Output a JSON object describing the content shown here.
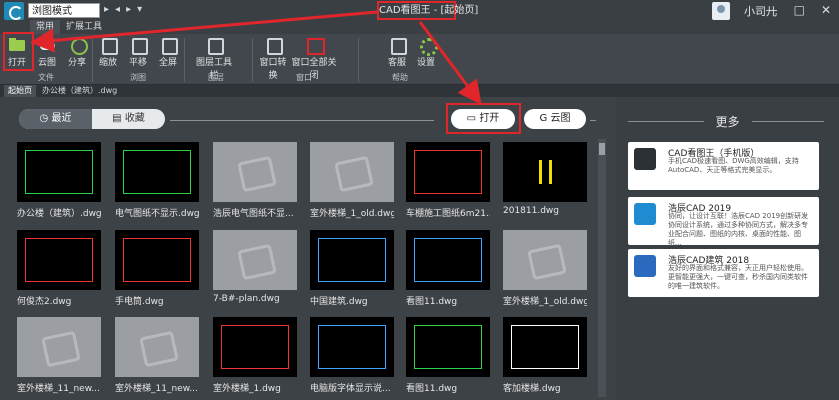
{
  "titlebar": {
    "mode": "浏图模式",
    "title": "CAD看图王 - [起始页]",
    "user_name": "小司儿",
    "btn_min": "—",
    "btn_max": "□",
    "btn_close": "✕"
  },
  "menu_tabs": [
    "常用",
    "扩展工具"
  ],
  "ribbon": {
    "buttons": [
      "打开",
      "云图",
      "分享",
      "缩放",
      "平移",
      "全屏",
      "图层工具栏",
      "窗口转换",
      "窗口全部关闭",
      "客服",
      "设置"
    ],
    "groups": [
      "文件",
      "浏图",
      "图层",
      "窗口",
      "帮助"
    ]
  },
  "doc_tabs": [
    "起始页",
    "办公楼（建筑）.dwg"
  ],
  "main": {
    "seg_recent": "最近",
    "seg_fav": "收藏",
    "open_btn": "打开",
    "cloud_btn": "云图"
  },
  "files": [
    {
      "name": "办公楼（建筑）.dwg"
    },
    {
      "name": "电气图纸不显示.dwg"
    },
    {
      "name": "浩辰电气图纸不显..."
    },
    {
      "name": "室外楼梯_1_old.dwg"
    },
    {
      "name": "车棚施工图纸6m21..."
    },
    {
      "name": "201811.dwg"
    },
    {
      "name": "何俊杰2.dwg"
    },
    {
      "name": "手电筒.dwg"
    },
    {
      "name": "7-B#-plan.dwg"
    },
    {
      "name": "中国建筑.dwg"
    },
    {
      "name": "看图11.dwg"
    },
    {
      "name": "室外楼梯_1_old.dwg"
    },
    {
      "name": "室外楼梯_11_new..."
    },
    {
      "name": "室外楼梯_11_new..."
    },
    {
      "name": "室外楼梯_1.dwg"
    },
    {
      "name": "电脑版字体显示说..."
    },
    {
      "name": "看图11.dwg"
    },
    {
      "name": "客加楼梯.dwg"
    }
  ],
  "side": {
    "title": "更多",
    "cards": [
      {
        "title": "CAD看图王（手机版）",
        "desc": "手机CAD极速看图、DWG高效编辑，支持AutoCAD、天正等格式完美显示。",
        "color": "#2c3136"
      },
      {
        "title": "浩辰CAD 2019",
        "desc": "协同，让设计互联！浩辰CAD 2019创新研发协同设计系统，通过多种协同方式，解决多专业配合问题、图纸的内核、桌面的性能、图纸...",
        "color": "#1f8bd0"
      },
      {
        "title": "浩辰CAD建筑 2018",
        "desc": "友好的界面和格式兼容，天正用户轻松使用。更智能更强大，一键可查，秒杀国内同类软件的唯一建筑软件。",
        "color": "#2a6bbf"
      }
    ]
  },
  "colors": {
    "highlight": "#e0262b",
    "accent_green": "#8bc34a"
  }
}
